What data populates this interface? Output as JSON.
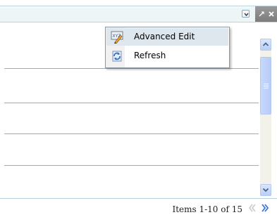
{
  "header": {
    "menu_icon": "chevron-down-icon",
    "restore_icon": "minmax-icon",
    "close_icon": "close-icon"
  },
  "context_menu": {
    "items": [
      {
        "label": "Advanced Edit",
        "icon": "xml-edit-icon"
      },
      {
        "label": "Refresh",
        "icon": "refresh-icon"
      }
    ]
  },
  "pagination": {
    "items_label": "Items 1-10 of 15",
    "prev_icon": "chevron-left-double-icon",
    "next_icon": "chevron-right-double-icon"
  },
  "scrollbar": {
    "up_icon": "arrow-up-icon",
    "down_icon": "arrow-down-icon"
  },
  "colors": {
    "header_background": "#eef5f7",
    "accent_blue": "#3d74d8",
    "menu_highlight": "#dee7ee"
  }
}
